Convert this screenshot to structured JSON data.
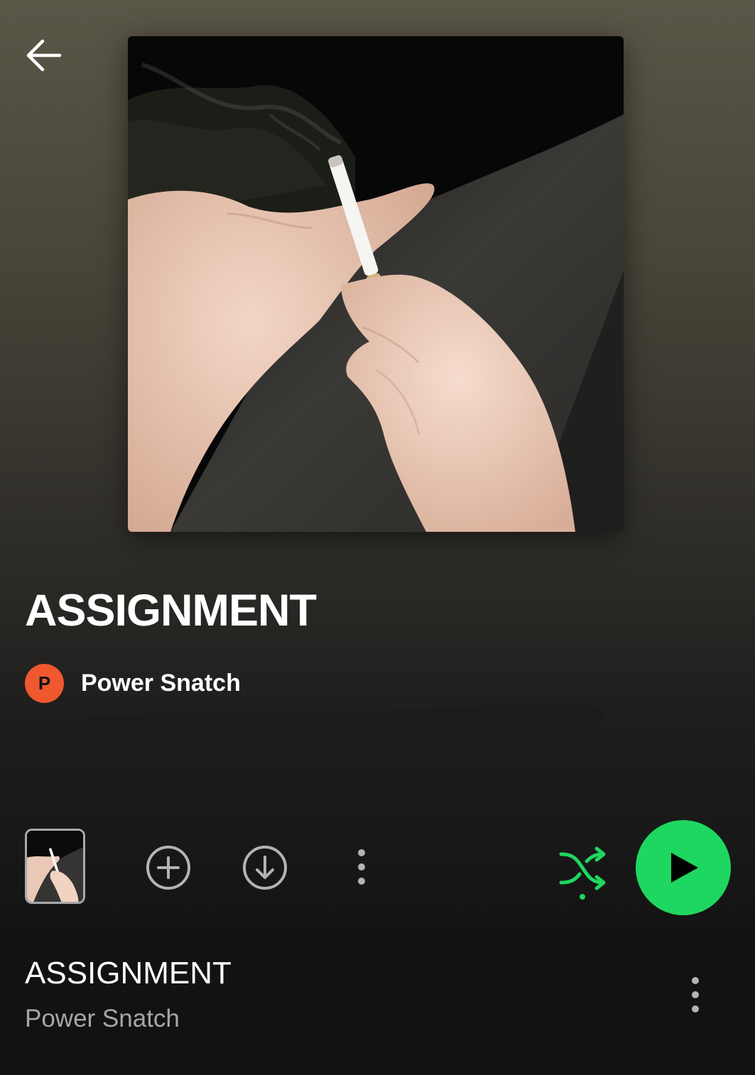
{
  "header": {
    "back_icon": "arrow-left-icon"
  },
  "album": {
    "cover_description_icon": "album-cover-art",
    "title": "ASSIGNMENT",
    "artist_initial": "P",
    "artist_name": "Power Snatch"
  },
  "actions": {
    "add_icon": "plus-circle-icon",
    "download_icon": "download-circle-icon",
    "more_icon": "more-vertical-icon",
    "shuffle_icon": "shuffle-icon",
    "play_icon": "play-icon"
  },
  "tracks": [
    {
      "title": "ASSIGNMENT",
      "artist": "Power Snatch",
      "more_icon": "more-vertical-icon"
    }
  ],
  "colors": {
    "accent": "#1ed760",
    "avatar": "#f0582f",
    "secondary_text": "#a7a7a7",
    "background": "#121212"
  }
}
